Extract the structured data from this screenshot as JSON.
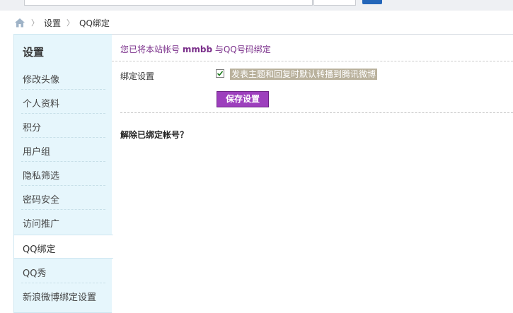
{
  "breadcrumb": {
    "items": [
      "设置",
      "QQ绑定"
    ]
  },
  "sidebar": {
    "title": "设置",
    "items": [
      {
        "label": "修改头像"
      },
      {
        "label": "个人资料"
      },
      {
        "label": "积分"
      },
      {
        "label": "用户组"
      },
      {
        "label": "隐私筛选"
      },
      {
        "label": "密码安全"
      },
      {
        "label": "访问推广"
      },
      {
        "label": "QQ绑定"
      },
      {
        "label": "QQ秀"
      },
      {
        "label": "新浪微博绑定设置"
      }
    ],
    "active_index": 7
  },
  "main": {
    "bind_info_prefix": "您已将本站帐号",
    "bind_info_username": "mmbb",
    "bind_info_suffix": "与QQ号码绑定",
    "setting_label": "绑定设置",
    "checkbox_label": "发表主题和回复时默认转播到腾讯微博",
    "checkbox_checked": true,
    "save_button": "保存设置",
    "unbind_title": "解除已绑定帐号？"
  },
  "colors": {
    "sidebar_bg": "#e6f6fc",
    "accent_purple": "#9d3fbd",
    "info_text": "#7a2f8a"
  }
}
